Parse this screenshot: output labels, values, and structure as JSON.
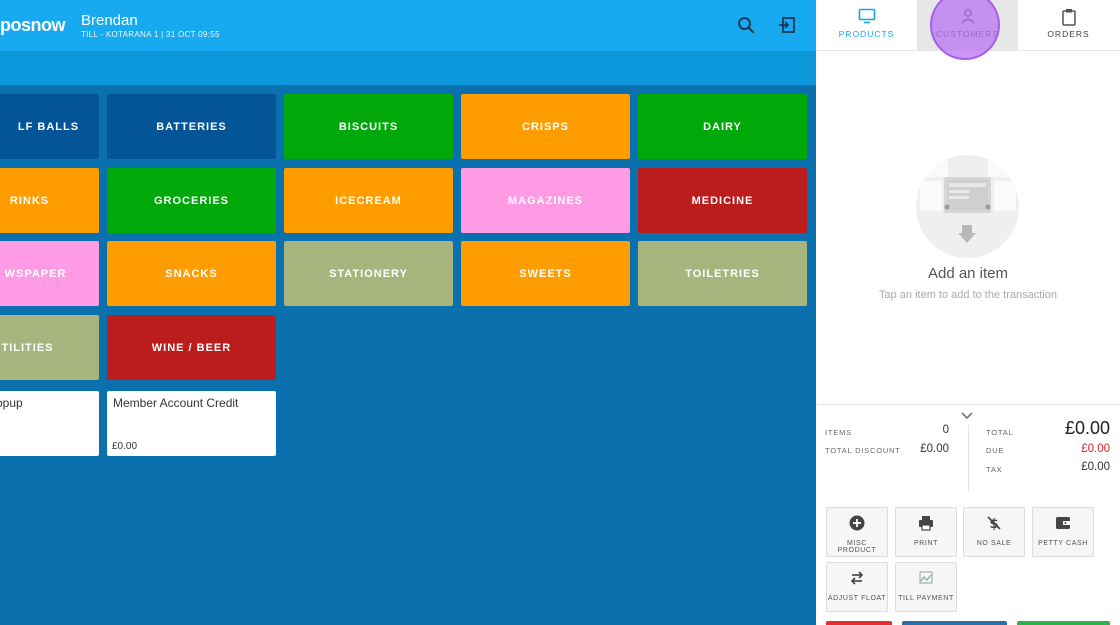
{
  "header": {
    "logo": "posnow",
    "user_name": "Brendan",
    "till_info": "TILL - KOTARANA 1 | 31 OCT 09:55",
    "search_icon": "search-icon",
    "logout_icon": "logout-icon"
  },
  "categories": [
    {
      "label": "LF BALLS",
      "color": "#035597"
    },
    {
      "label": "BATTERIES",
      "color": "#035597"
    },
    {
      "label": "BISCUITS",
      "color": "#00a80a"
    },
    {
      "label": "CRISPS",
      "color": "#ff9d00"
    },
    {
      "label": "DAIRY",
      "color": "#00a80a"
    },
    {
      "label": "RINKS",
      "color": "#ff9d00"
    },
    {
      "label": "GROCERIES",
      "color": "#00a80a"
    },
    {
      "label": "ICECREAM",
      "color": "#ff9d00"
    },
    {
      "label": "MAGAZINES",
      "color": "#ff9ae5"
    },
    {
      "label": "MEDICINE",
      "color": "#bb1c1c"
    },
    {
      "label": "WSPAPER",
      "color": "#ff9ae5"
    },
    {
      "label": "SNACKS",
      "color": "#ff9d00"
    },
    {
      "label": "STATIONERY",
      "color": "#a8b47e"
    },
    {
      "label": "SWEETS",
      "color": "#ff9d00"
    },
    {
      "label": "TOILETRIES",
      "color": "#a8b47e"
    },
    {
      "label": "TILITIES",
      "color": "#a8b47e"
    },
    {
      "label": "WINE / BEER",
      "color": "#bb1c1c"
    }
  ],
  "products": [
    {
      "title": "opup",
      "price": ""
    },
    {
      "title": "Member Account Credit",
      "price": "£0.00"
    }
  ],
  "tabs": [
    {
      "label": "PRODUCTS",
      "icon": "monitor-icon"
    },
    {
      "label": "CUSTOMERS",
      "icon": "person-icon"
    },
    {
      "label": "ORDERS",
      "icon": "clipboard-icon"
    }
  ],
  "transaction": {
    "empty_title": "Add an item",
    "empty_subtitle": "Tap an item to add to the transaction"
  },
  "totals": {
    "items_label": "ITEMS",
    "items_value": "0",
    "discount_label": "TOTAL DISCOUNT",
    "discount_value": "£0.00",
    "total_label": "TOTAL",
    "total_value": "£0.00",
    "due_label": "DUE",
    "due_value": "£0.00",
    "tax_label": "TAX",
    "tax_value": "£0.00",
    "due_color": "#e02020"
  },
  "actions": [
    {
      "label": "MISC PRODUCT",
      "icon": "plus-circle-icon"
    },
    {
      "label": "PRINT",
      "icon": "printer-icon"
    },
    {
      "label": "NO SALE",
      "icon": "no-money-icon"
    },
    {
      "label": "PETTY CASH",
      "icon": "wallet-icon"
    },
    {
      "label": "ADJUST FLOAT",
      "icon": "swap-icon"
    },
    {
      "label": "TILL PAYMENT",
      "icon": "broken-image-icon"
    }
  ],
  "colors": {
    "accent": "#17aaf0",
    "background": "#0a70ae",
    "focus": "#b873f3"
  }
}
